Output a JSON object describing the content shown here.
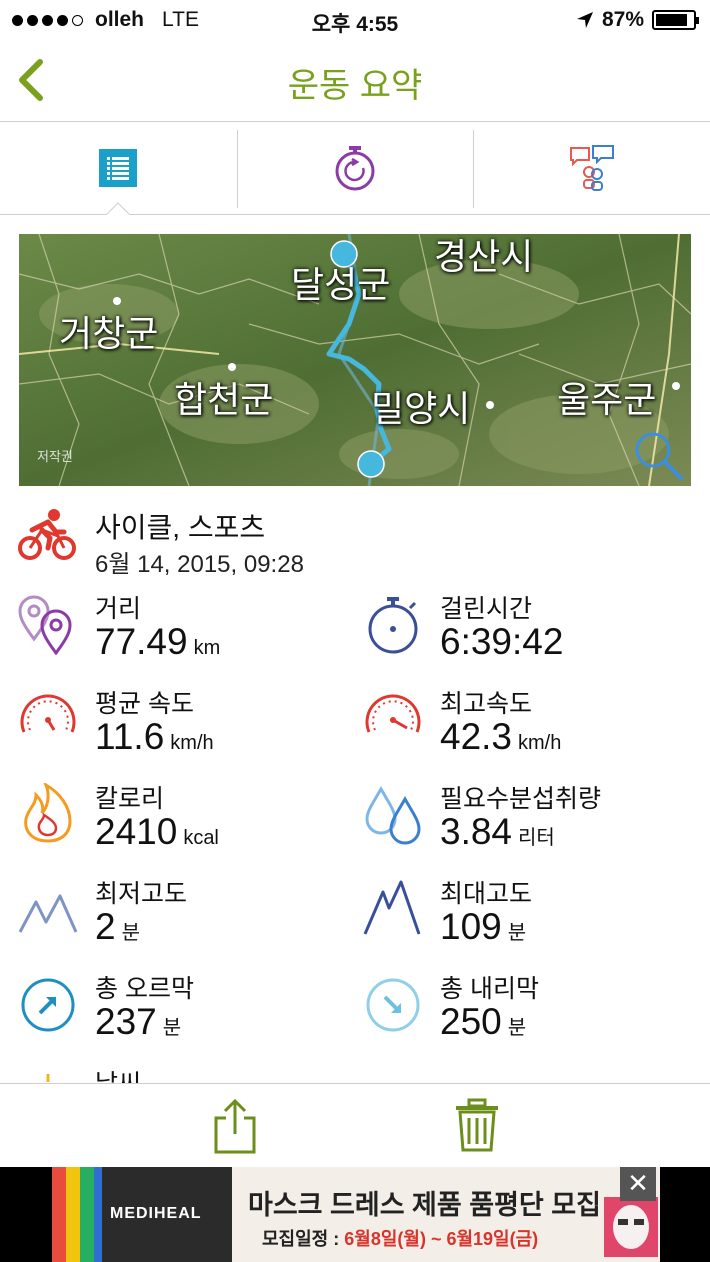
{
  "status_bar": {
    "carrier": "olleh",
    "network": "LTE",
    "time": "오후 4:55",
    "battery": "87%",
    "battery_level": 0.87,
    "signal_bars": 4
  },
  "nav": {
    "title": "운동 요약",
    "accent_color": "#7aa11e"
  },
  "tabs": [
    {
      "icon": "list-icon",
      "selected": true
    },
    {
      "icon": "timer-icon",
      "selected": false
    },
    {
      "icon": "social-chat-icon",
      "selected": false
    }
  ],
  "map": {
    "labels": [
      "경산시",
      "달성군",
      "거창군",
      "합천군",
      "밀양시",
      "울주군"
    ],
    "credit": "저작권"
  },
  "activity": {
    "type": "사이클, 스포츠",
    "date": "6월 14, 2015, 09:28"
  },
  "stats": [
    {
      "icon": "distance-icon",
      "label": "거리",
      "value": "77.49",
      "unit": "km"
    },
    {
      "icon": "stopwatch-icon",
      "label": "걸린시간",
      "value": "6:39:42",
      "unit": ""
    },
    {
      "icon": "avg-speed-icon",
      "label": "평균 속도",
      "value": "11.6",
      "unit": "km/h"
    },
    {
      "icon": "max-speed-icon",
      "label": "최고속도",
      "value": "42.3",
      "unit": "km/h"
    },
    {
      "icon": "calories-icon",
      "label": "칼로리",
      "value": "2410",
      "unit": "kcal"
    },
    {
      "icon": "water-drops-icon",
      "label": "필요수분섭취량",
      "value": "3.84",
      "unit": "리터"
    },
    {
      "icon": "min-altitude-icon",
      "label": "최저고도",
      "value": "2",
      "unit": "분"
    },
    {
      "icon": "max-altitude-icon",
      "label": "최대고도",
      "value": "109",
      "unit": "분"
    },
    {
      "icon": "ascent-icon",
      "label": "총 오르막",
      "value": "237",
      "unit": "분"
    },
    {
      "icon": "descent-icon",
      "label": "총 내리막",
      "value": "250",
      "unit": "분"
    },
    {
      "icon": "weather-sun-icon",
      "label": "날씨",
      "value": "",
      "unit": ""
    }
  ],
  "bottom_bar": {
    "share_icon": "share-icon",
    "delete_icon": "trash-icon"
  },
  "ad": {
    "brand": "MEDIHEAL",
    "title": "마스크 드레스 제품 품평단 모집",
    "sub_prefix": "모집일정 : ",
    "sub_dates": "6월8일(월) ~ 6월19일(금)",
    "close": "✕"
  }
}
